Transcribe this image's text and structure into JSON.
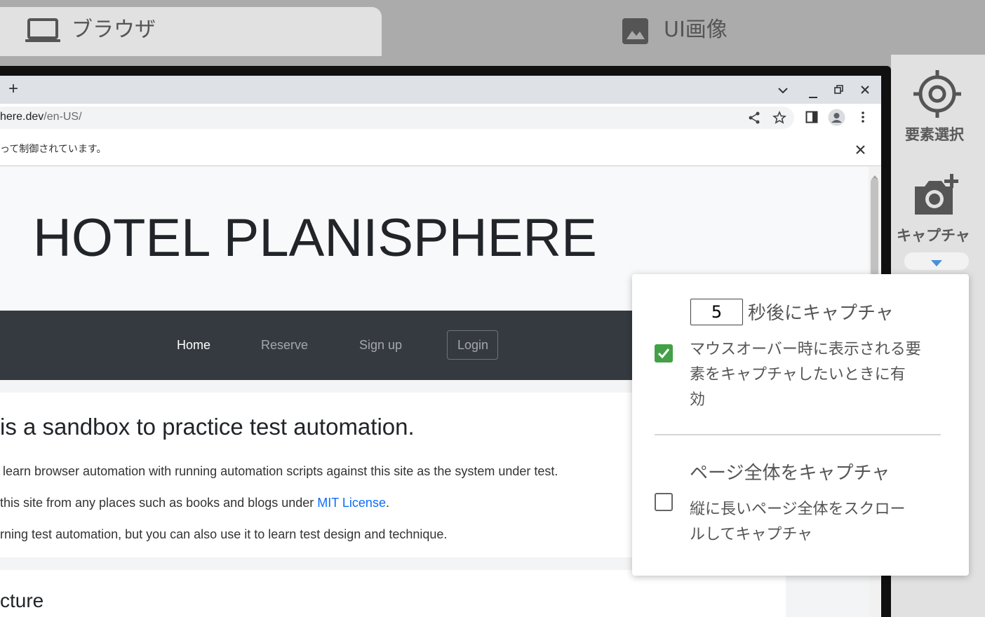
{
  "tabs": {
    "browser_label": "ブラウザ",
    "ui_image_label": "UI画像",
    "browser_icon": "laptop-icon",
    "ui_image_icon": "image-icon"
  },
  "tools": {
    "select_element_label": "要素選択",
    "capture_label": "キャプチャ",
    "select_icon": "crosshair-icon",
    "capture_icon": "camera-add-icon"
  },
  "browser": {
    "new_tab_symbol": "+",
    "url_host": "here.dev",
    "url_path": "/en-US/",
    "infobar_text": "って制御されています。"
  },
  "site": {
    "title": "HOTEL PLANISPHERE",
    "nav": {
      "home": "Home",
      "reserve": "Reserve",
      "signup": "Sign up",
      "login": "Login"
    },
    "heading": "is a sandbox to practice test automation.",
    "p1": "learn browser automation with running automation scripts against this site as the system under test.",
    "p2_before": "this site from any places such as books and blogs under ",
    "p2_link": "MIT License",
    "p2_after": ".",
    "p3": "rning test automation, but you can also use it to learn test design and technique.",
    "section_heading": "cture"
  },
  "capture_popup": {
    "delay_value": "5",
    "delay_label": "秒後にキャプチャ",
    "hover_checked": true,
    "hover_desc_line1": "マウスオーバー時に表示される要",
    "hover_desc_line2": "素をキャプチャしたいときに有",
    "hover_desc_line3": "効",
    "full_title": "ページ全体をキャプチャ",
    "full_checked": false,
    "full_desc_line1": "縦に長いページ全体をスクロー",
    "full_desc_line2": "ルしてキャプチャ"
  },
  "colors": {
    "accent_green": "#43a047",
    "accent_blue": "#4a90d9",
    "nav_bg": "#343a40",
    "link": "#0d6efd"
  }
}
